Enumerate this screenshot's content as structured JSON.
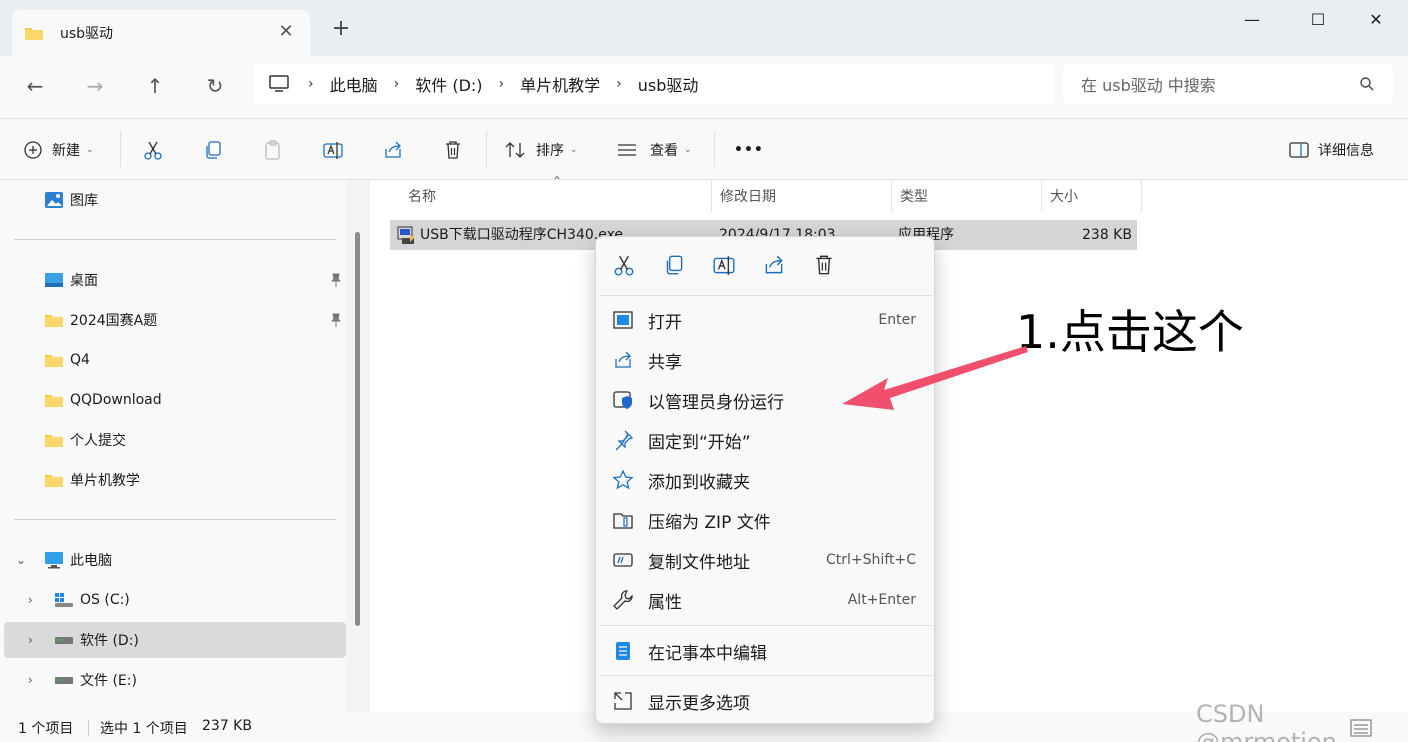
{
  "window": {
    "tab_title": "usb驱动",
    "tab_close": "✕",
    "tab_add": "+",
    "minimize": "—",
    "maximize": "☐",
    "close": "✕"
  },
  "nav": {
    "back": "←",
    "forward": "→",
    "up": "↑",
    "refresh": "↻",
    "breadcrumb": [
      "此电脑",
      "软件 (D:)",
      "单片机教学",
      "usb驱动"
    ],
    "crumb_sep": "›",
    "search_placeholder": "在 usb驱动 中搜索"
  },
  "toolbar": {
    "new_label": "新建",
    "sort_label": "排序",
    "view_label": "查看",
    "more_label": "•••",
    "details_label": "详细信息",
    "caret": "⌄"
  },
  "sidebar": {
    "gallery": "图库",
    "pinned": [
      "桌面",
      "2024国赛A题",
      "Q4",
      "QQDownload",
      "个人提交",
      "单片机教学"
    ],
    "this_pc": "此电脑",
    "drives": [
      "OS (C:)",
      "软件 (D:)",
      "文件 (E:)"
    ],
    "chevron_down": "⌄",
    "chevron_right": "›"
  },
  "file_list": {
    "columns": [
      "名称",
      "修改日期",
      "类型",
      "大小"
    ],
    "sort_caret": "⌃",
    "rows": [
      {
        "name": "USB下载口驱动程序CH340.exe",
        "date": "2024/9/17 18:03",
        "type": "应用程序",
        "size": "238 KB"
      }
    ]
  },
  "statusbar": {
    "count": "1 个项目",
    "selected": "选中 1 个项目",
    "selected_size": "237 KB"
  },
  "context_menu": {
    "items": [
      {
        "label": "打开",
        "shortcut": "Enter"
      },
      {
        "label": "共享",
        "shortcut": ""
      },
      {
        "label": "以管理员身份运行",
        "shortcut": ""
      },
      {
        "label": "固定到“开始”",
        "shortcut": ""
      },
      {
        "label": "添加到收藏夹",
        "shortcut": ""
      },
      {
        "label": "压缩为 ZIP 文件",
        "shortcut": ""
      },
      {
        "label": "复制文件地址",
        "shortcut": "Ctrl+Shift+C"
      },
      {
        "label": "属性",
        "shortcut": "Alt+Enter"
      }
    ],
    "notepad": "在记事本中编辑",
    "more": "显示更多选项"
  },
  "annotation": {
    "text": "1.点击这个",
    "arrow_color": "#f0506e"
  },
  "watermark": "CSDN @mrmotion",
  "colors": {
    "folder": "#f8c94c",
    "accent": "#005fb8",
    "selected_row": "#d5d5d5"
  }
}
